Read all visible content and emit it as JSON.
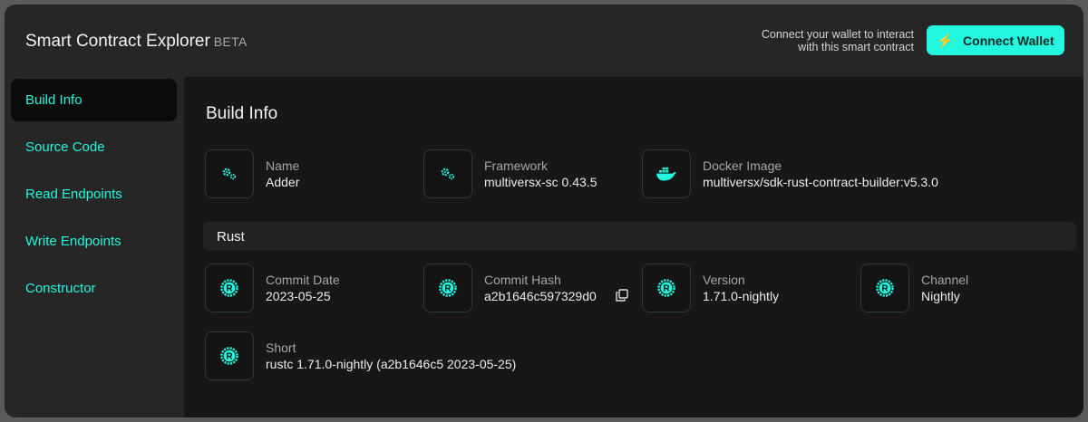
{
  "header": {
    "title": "Smart Contract Explorer",
    "badge": "BETA",
    "connect_message_line1": "Connect your wallet to interact",
    "connect_message_line2": "with this smart contract",
    "connect_button": "Connect Wallet"
  },
  "sidebar": {
    "items": [
      {
        "label": "Build Info",
        "active": true
      },
      {
        "label": "Source Code",
        "active": false
      },
      {
        "label": "Read Endpoints",
        "active": false
      },
      {
        "label": "Write Endpoints",
        "active": false
      },
      {
        "label": "Constructor",
        "active": false
      }
    ]
  },
  "main": {
    "title": "Build Info",
    "contract_fields": [
      {
        "label": "Name",
        "value": "Adder",
        "icon": "gears-icon"
      },
      {
        "label": "Framework",
        "value": "multiversx-sc 0.43.5",
        "icon": "gears-icon"
      },
      {
        "label": "Docker Image",
        "value": "multiversx/sdk-rust-contract-builder:v5.3.0",
        "icon": "docker-icon"
      }
    ],
    "rust_section": "Rust",
    "rust_fields": [
      {
        "label": "Commit Date",
        "value": "2023-05-25",
        "icon": "rust-icon"
      },
      {
        "label": "Commit Hash",
        "value": "a2b1646c597329d0",
        "icon": "rust-icon"
      },
      {
        "label": "Version",
        "value": "1.71.0-nightly",
        "icon": "rust-icon"
      },
      {
        "label": "Channel",
        "value": "Nightly",
        "icon": "rust-icon"
      },
      {
        "label": "Short",
        "value": "rustc 1.71.0-nightly (a2b1646c5 2023-05-25)",
        "icon": "rust-icon"
      }
    ]
  },
  "colors": {
    "accent": "#23f7dd",
    "panel": "#262626",
    "content": "#171717"
  }
}
